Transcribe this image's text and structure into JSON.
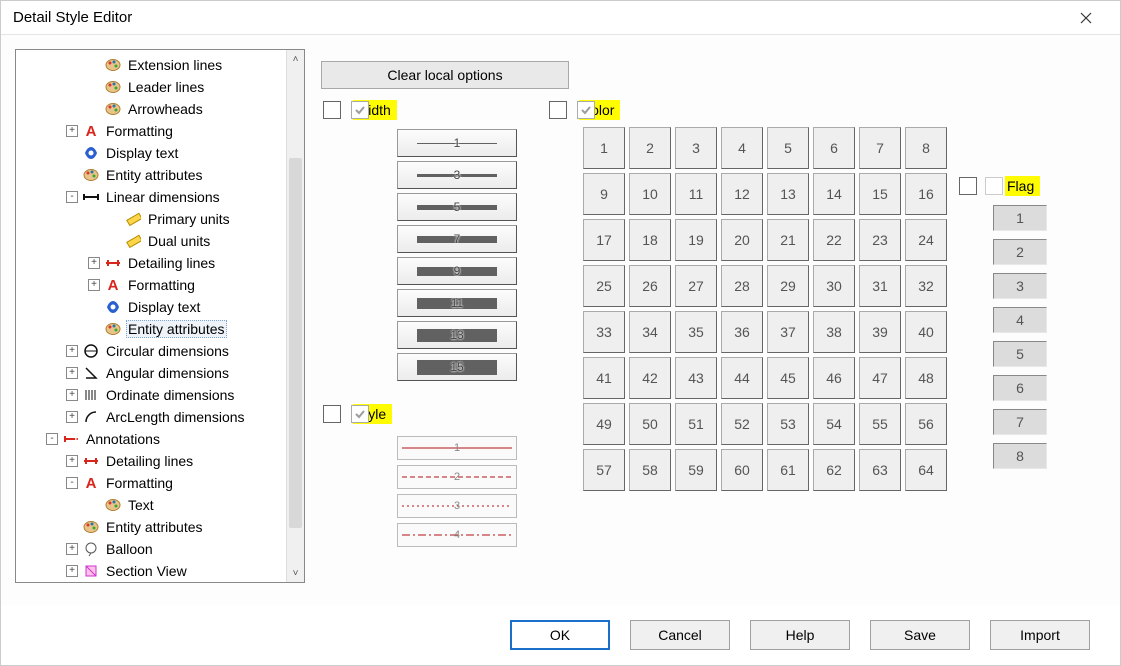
{
  "window": {
    "title": "Detail Style Editor"
  },
  "buttons": {
    "clear_local": "Clear local options",
    "ok": "OK",
    "cancel": "Cancel",
    "help": "Help",
    "save": "Save",
    "import": "Import"
  },
  "sections": {
    "width": {
      "label": "Width",
      "values": [
        "1",
        "3",
        "5",
        "7",
        "9",
        "11",
        "13",
        "15"
      ]
    },
    "style": {
      "label": "Style",
      "values": [
        "1",
        "2",
        "3",
        "4"
      ]
    },
    "color": {
      "label": "Color",
      "count": 64
    },
    "flag": {
      "label": "Flag",
      "values": [
        "1",
        "2",
        "3",
        "4",
        "5",
        "6",
        "7",
        "8"
      ]
    }
  },
  "tree": {
    "items": [
      {
        "depth": "pad0",
        "exp": "",
        "icon": "palette",
        "label": "Extension lines"
      },
      {
        "depth": "pad0",
        "exp": "",
        "icon": "palette",
        "label": "Leader lines"
      },
      {
        "depth": "pad0",
        "exp": "",
        "icon": "palette",
        "label": "Arrowheads"
      },
      {
        "depth": "pad1",
        "exp": "+",
        "icon": "A",
        "label": "Formatting"
      },
      {
        "depth": "pad1",
        "exp": "",
        "icon": "disp",
        "label": "Display text"
      },
      {
        "depth": "pad1",
        "exp": "",
        "icon": "palette",
        "label": "Entity attributes"
      },
      {
        "depth": "pad1",
        "exp": "-",
        "icon": "liner",
        "label": "Linear dimensions"
      },
      {
        "depth": "pad3",
        "exp": "",
        "icon": "ruler",
        "label": "Primary units"
      },
      {
        "depth": "pad3",
        "exp": "",
        "icon": "ruler",
        "label": "Dual units"
      },
      {
        "depth": "pad2",
        "exp": "+",
        "icon": "detline",
        "label": "Detailing lines"
      },
      {
        "depth": "pad2",
        "exp": "+",
        "icon": "A",
        "label": "Formatting"
      },
      {
        "depth": "pad2",
        "exp": "",
        "icon": "disp",
        "label": "Display text"
      },
      {
        "depth": "pad2",
        "exp": "",
        "icon": "palette",
        "label": "Entity attributes",
        "selected": true
      },
      {
        "depth": "pad1",
        "exp": "+",
        "icon": "circ",
        "label": "Circular dimensions"
      },
      {
        "depth": "pad1",
        "exp": "+",
        "icon": "ang",
        "label": "Angular dimensions"
      },
      {
        "depth": "pad1",
        "exp": "+",
        "icon": "ord",
        "label": "Ordinate dimensions"
      },
      {
        "depth": "pad1",
        "exp": "+",
        "icon": "arc",
        "label": "ArcLength dimensions"
      },
      {
        "depth": "padA",
        "exp": "-",
        "icon": "annot",
        "label": "Annotations"
      },
      {
        "depth": "padB",
        "exp": "+",
        "icon": "detline",
        "label": "Detailing lines"
      },
      {
        "depth": "padB",
        "exp": "-",
        "icon": "A",
        "label": "Formatting"
      },
      {
        "depth": "pad0",
        "exp": "",
        "icon": "palette",
        "label": "Text"
      },
      {
        "depth": "padB",
        "exp": "",
        "icon": "palette",
        "label": "Entity attributes"
      },
      {
        "depth": "padB",
        "exp": "+",
        "icon": "balloon",
        "label": "Balloon"
      },
      {
        "depth": "padB",
        "exp": "+",
        "icon": "section",
        "label": "Section View"
      }
    ]
  }
}
